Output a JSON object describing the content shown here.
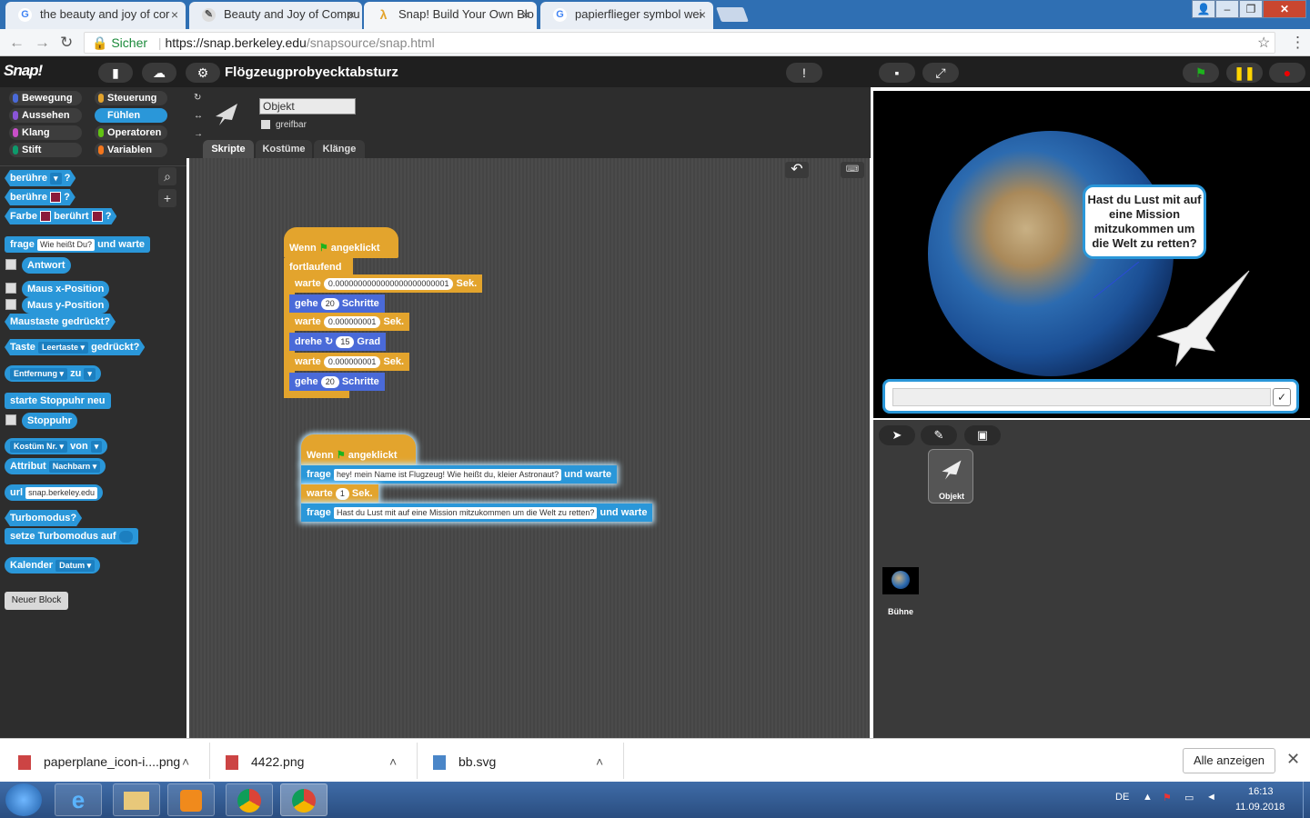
{
  "browser": {
    "tabs": [
      {
        "title": "the beauty and joy of cor",
        "favicon": "google-icon",
        "active": false
      },
      {
        "title": "Beauty and Joy of Compu",
        "favicon": "bjc-icon",
        "active": false
      },
      {
        "title": "Snap! Build Your Own Blo",
        "favicon": "snap-icon",
        "active": true
      },
      {
        "title": "papierflieger symbol wei",
        "favicon": "google-icon",
        "active": false
      }
    ],
    "secure_label": "Sicher",
    "url_host": "https://snap.berkeley.edu",
    "url_path": "/snapsource/snap.html"
  },
  "snap": {
    "logo": "Snap!",
    "project_title": "Flögzeugprobyecktabsturz",
    "categories": [
      {
        "label": "Bewegung",
        "color": "#4a6ad8",
        "selected": false
      },
      {
        "label": "Steuerung",
        "color": "#e3a42d",
        "selected": false
      },
      {
        "label": "Aussehen",
        "color": "#8a55d7",
        "selected": false
      },
      {
        "label": "Fühlen",
        "color": "#2a97d9",
        "selected": true
      },
      {
        "label": "Klang",
        "color": "#c94fc9",
        "selected": false
      },
      {
        "label": "Operatoren",
        "color": "#62c213",
        "selected": false
      },
      {
        "label": "Stift",
        "color": "#0e9a6c",
        "selected": false
      },
      {
        "label": "Variablen",
        "color": "#f3761d",
        "selected": false
      }
    ],
    "palette": {
      "beruehre": "berühre",
      "beruehre2": "berühre",
      "q": "?",
      "farbe": "Farbe",
      "beruehrt": "berührt",
      "frage": "frage",
      "frage_input": "Wie heißt Du?",
      "und_warte": "und warte",
      "antwort": "Antwort",
      "maus_x": "Maus x-Position",
      "maus_y": "Maus y-Position",
      "maustaste": "Maustaste gedrückt?",
      "taste": "Taste",
      "taste_dd": "Leertaste",
      "gedrueckt": "gedrückt?",
      "entfernung": "Entfernung",
      "zu": "zu",
      "starte_stoppuhr": "starte Stoppuhr neu",
      "stoppuhr": "Stoppuhr",
      "kostuem_nr": "Kostüm Nr.",
      "von": "von",
      "attribut": "Attribut",
      "nachbarn": "Nachbarn",
      "url": "url",
      "url_input": "snap.berkeley.edu",
      "turbomodus": "Turbomodus?",
      "setze_turbo": "setze Turbomodus auf",
      "kalender": "Kalender",
      "datum": "Datum",
      "neuer_block": "Neuer Block"
    },
    "sprite": {
      "name": "Objekt",
      "draggable_label": "greifbar",
      "tabs": [
        "Skripte",
        "Kostüme",
        "Klänge"
      ]
    },
    "scripts": {
      "s1": {
        "hat_prefix": "Wenn",
        "hat_suffix": "angeklickt",
        "forever": "fortlaufend",
        "warte": "warte",
        "sek": "Sek.",
        "w1": "0.0000000000000000000000001",
        "gehe": "gehe",
        "schritte": "Schritte",
        "g1": "20",
        "w2": "0.000000001",
        "drehe": "drehe",
        "d1": "15",
        "grad": "Grad",
        "w3": "0.000000001",
        "g2": "20"
      },
      "s2": {
        "hat_prefix": "Wenn",
        "hat_suffix": "angeklickt",
        "frage": "frage",
        "q1": "hey! mein Name ist Flugzeug! Wie heißt du, kleier Astronaut?",
        "und_warte": "und warte",
        "warte": "warte",
        "w1": "1",
        "sek": "Sek.",
        "q2": "Hast du Lust mit auf eine Mission mitzukommen um die Welt zu retten?"
      }
    },
    "stage": {
      "speech": "Hast du Lust mit auf eine Mission mitzukommen um die Welt zu retten?",
      "ok": "✓"
    },
    "corral": {
      "sprite_label": "Objekt",
      "stage_label": "Bühne"
    }
  },
  "downloads": {
    "items": [
      "paperplane_icon-i....png",
      "4422.png",
      "bb.svg"
    ],
    "show_all": "Alle anzeigen"
  },
  "taskbar": {
    "lang": "DE",
    "time": "16:13",
    "date": "11.09.2018"
  }
}
